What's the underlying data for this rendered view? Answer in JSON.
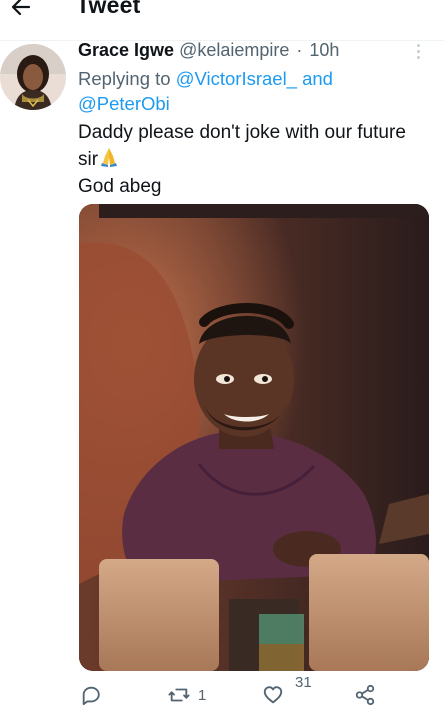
{
  "header": {
    "title": "Tweet"
  },
  "tweet": {
    "display_name": "Grace Igwe",
    "handle": "@kelaiempire",
    "separator": "·",
    "time": "10h",
    "replying_prefix": "Replying to ",
    "mentions": [
      "@VictorIsrael_",
      "@PeterObi"
    ],
    "mention_joiner": " and",
    "text_line1": "Daddy please don't joke with our future",
    "text_line2": "sir",
    "text_line3": "God abeg",
    "emoji": "folded-hands"
  },
  "actions": {
    "reply_count": "",
    "retweet_count": "1",
    "like_count": "31"
  },
  "icons": {
    "back": "arrow-left-icon",
    "more": "more-vertical-icon",
    "reply": "comment-icon",
    "retweet": "retweet-icon",
    "like": "heart-icon",
    "share": "share-icon"
  },
  "colors": {
    "link": "#1d9bf0",
    "secondary": "#536471",
    "text": "#0f1419"
  }
}
